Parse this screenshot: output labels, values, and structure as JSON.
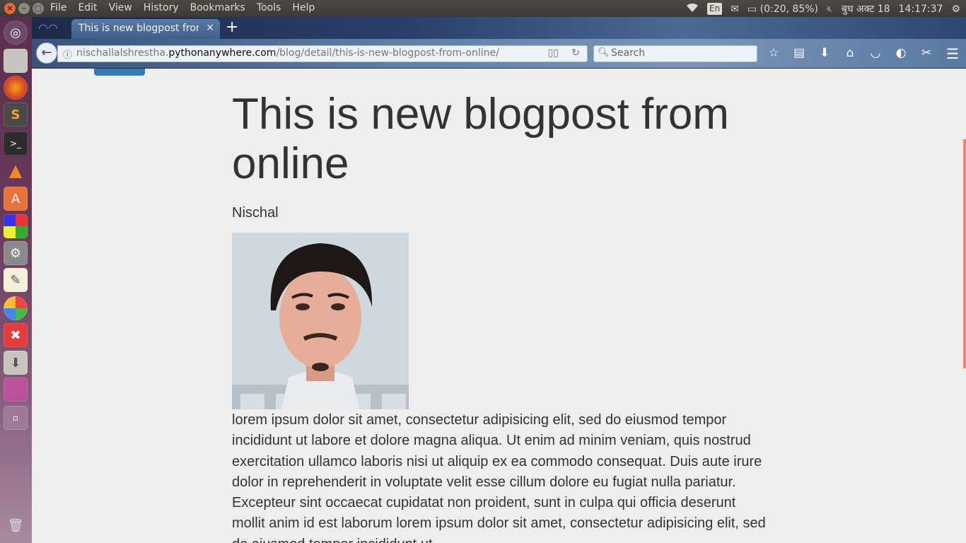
{
  "system": {
    "menubar": [
      "File",
      "Edit",
      "View",
      "History",
      "Bookmarks",
      "Tools",
      "Help"
    ],
    "input_lang": "En",
    "battery": "(0:20, 85%)",
    "date": "बुध अक्ट 18",
    "time": "14:17:37"
  },
  "launcher": {
    "items": [
      "dash-icon",
      "files-icon",
      "firefox-icon",
      "sublime-icon",
      "terminal-icon",
      "vlc-icon",
      "software-center-icon",
      "workspaces-icon",
      "system-settings-icon",
      "text-editor-icon",
      "pinta-icon",
      "xampp-icon",
      "installer-icon",
      "window-icon",
      "desktop-icon",
      "trash-icon"
    ]
  },
  "browser": {
    "tab_title": "This is new blogpost from online",
    "tab_close": "×",
    "new_tab": "+",
    "url_prefix": "nischallalshrestha.",
    "url_domain": "pythonanywhere.com",
    "url_path": "/blog/detail/this-is-new-blogpost-from-online/",
    "search_placeholder": "Search"
  },
  "page": {
    "title": "This is new blogpost from online",
    "author": "Nischal",
    "body": "lorem ipsum dolor sit amet, consectetur adipisicing elit, sed do eiusmod tempor incididunt ut labore et dolore magna aliqua. Ut enim ad minim veniam, quis nostrud exercitation ullamco laboris nisi ut aliquip ex ea commodo consequat. Duis aute irure dolor in reprehenderit in voluptate velit esse cillum dolore eu fugiat nulla pariatur. Excepteur sint occaecat cupidatat non proident, sunt in culpa qui officia deserunt mollit anim id est laborum lorem ipsum dolor sit amet, consectetur adipisicing elit, sed do eiusmod tempor incididunt ut"
  },
  "colors": {
    "page_bg": "#eeeeee",
    "accent_button": "#337ab7",
    "text": "#333333",
    "scrollbar": "#f08a5d"
  }
}
